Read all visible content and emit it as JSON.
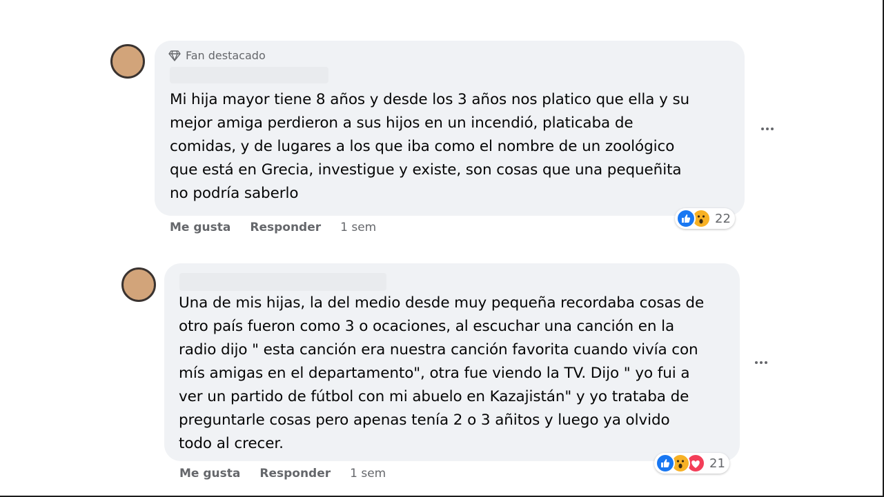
{
  "comments": [
    {
      "badge": "Fan destacado",
      "text": "Mi hija mayor tiene 8 años y desde los 3 años nos platico que ella y su\nmejor amiga perdieron a sus hijos en un incendió, platicaba de\ncomidas, y de lugares a los que iba como el nombre de un zoológico\nque está en Grecia, investigue y existe, son cosas que una pequeñita\nno podría saberlo",
      "like_label": "Me gusta",
      "reply_label": "Responder",
      "time": "1 sem",
      "reaction_count": "22",
      "reactions": [
        "like-icon",
        "wow-icon"
      ]
    },
    {
      "text": "Una de mis hijas, la del medio desde muy pequeña recordaba cosas de\notro país fueron como 3 o ocaciones, al escuchar una canción en la\nradio dijo \" esta canción era nuestra canción favorita cuando vivía con\nmís amigas en el departamento\", otra fue viendo la TV. Dijo \" yo fui a\nver un partido de fútbol con mi abuelo en Kazajistán\" y yo trataba de\npreguntarle cosas pero apenas tenía 2 o 3 añitos y luego ya olvido\ntodo al crecer.",
      "like_label": "Me gusta",
      "reply_label": "Responder",
      "time": "1 sem",
      "reaction_count": "21",
      "reactions": [
        "like-icon",
        "wow-icon",
        "love-icon"
      ]
    }
  ],
  "colors": {
    "bubble": "#f0f2f5",
    "meta_text": "#65676b",
    "like_blue": "#1877f2",
    "wow_yellow": "#f7b125",
    "love_red": "#f33e58"
  }
}
